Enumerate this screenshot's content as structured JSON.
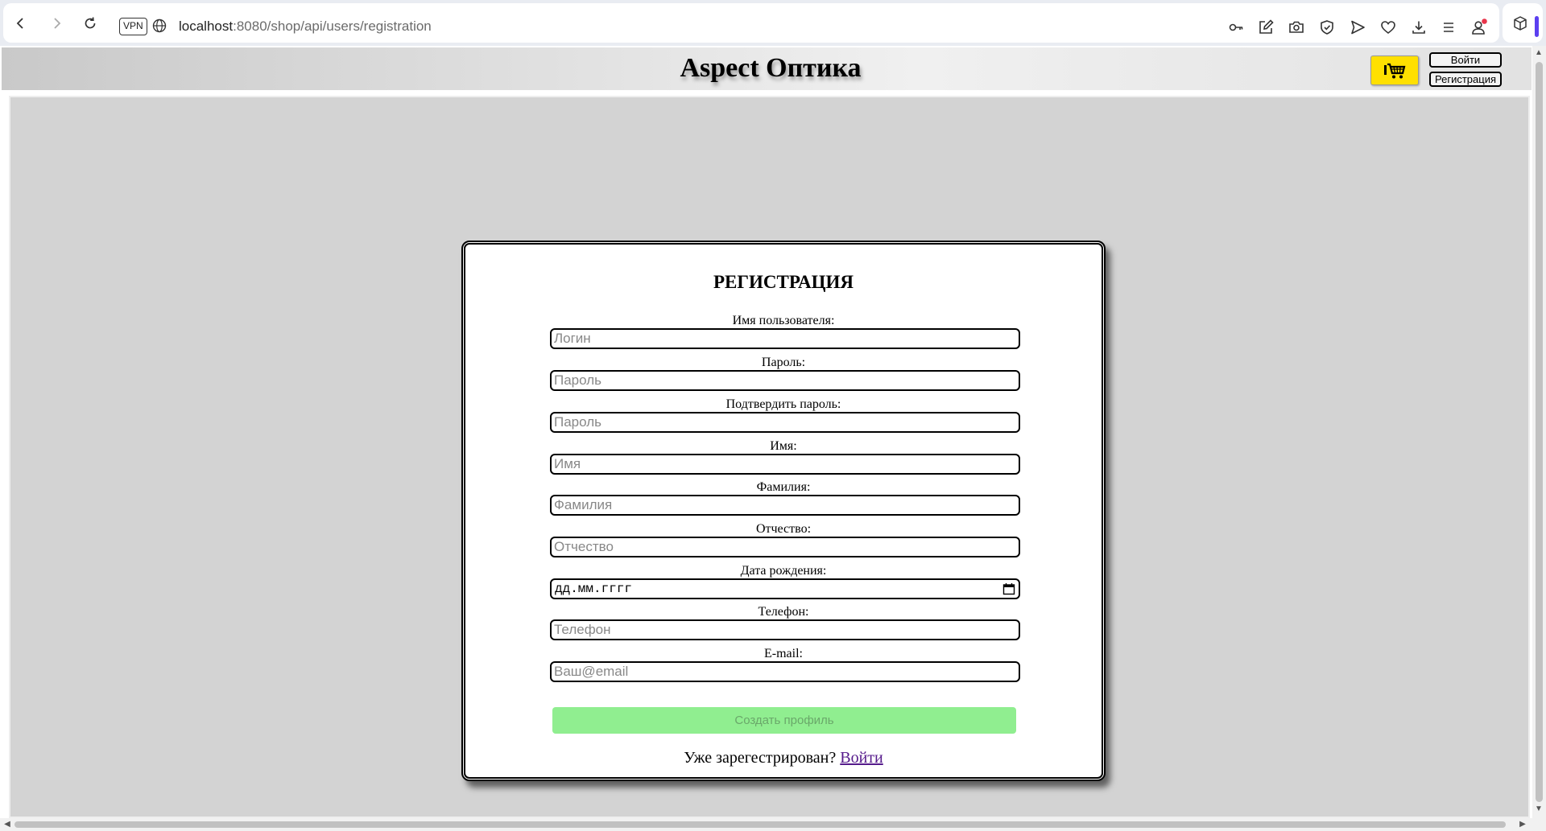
{
  "browser": {
    "vpn_label": "VPN",
    "url_host": "localhost",
    "url_path": ":8080/shop/api/users/registration",
    "toolbar_icons": [
      "key-icon",
      "edit-icon",
      "camera-icon",
      "shield-icon",
      "send-icon",
      "heart-icon",
      "download-icon",
      "menu-icon",
      "profile-icon",
      "cube-icon"
    ],
    "accent_color": "#5b3ff0",
    "notification_color": "#e8344a"
  },
  "header": {
    "site_title": "Aspect Оптика",
    "cart_icon": "cart-icon",
    "cart_color": "#ffe000",
    "login_label": "Войти",
    "register_label": "Регистрация"
  },
  "form": {
    "title": "РЕГИСТРАЦИЯ",
    "fields": [
      {
        "label": "Имя пользователя:",
        "placeholder": "Логин"
      },
      {
        "label": "Пароль:",
        "placeholder": "Пароль"
      },
      {
        "label": "Подтвердить пароль:",
        "placeholder": "Пароль"
      },
      {
        "label": "Имя:",
        "placeholder": "Имя"
      },
      {
        "label": "Фамилия:",
        "placeholder": "Фамилия"
      },
      {
        "label": "Отчество:",
        "placeholder": "Отчество"
      },
      {
        "label": "Дата рождения:",
        "placeholder": "дд.мм.гггг"
      },
      {
        "label": "Телефон:",
        "placeholder": "Телефон"
      },
      {
        "label": "E-mail:",
        "placeholder": "Ваш@email"
      }
    ],
    "submit_label": "Создать профиль",
    "submit_color": "#90ee90",
    "login_prompt": "Уже зарегестрирован?",
    "login_link": "Войти"
  }
}
